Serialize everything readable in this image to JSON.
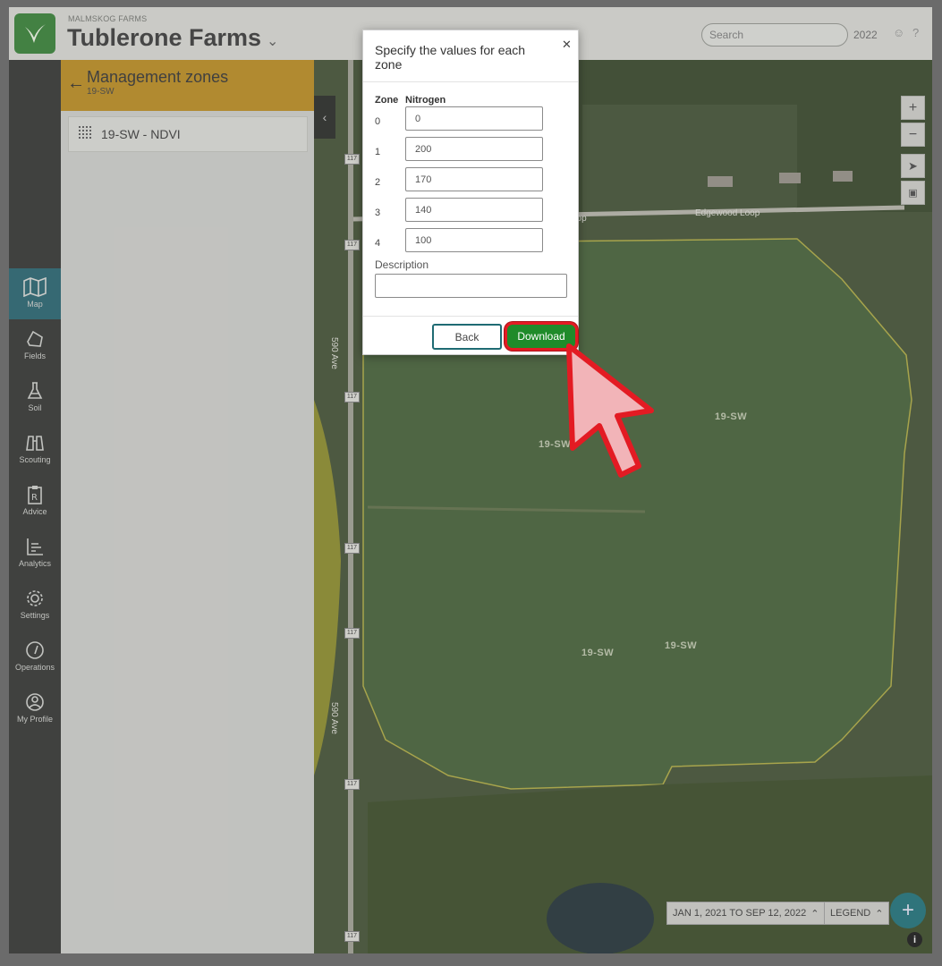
{
  "header": {
    "org": "MALMSKOG FARMS",
    "farm_name": "Tublerone Farms",
    "search_placeholder": "Search",
    "year": "2022"
  },
  "nav": [
    {
      "label": "Map",
      "icon": "map-icon",
      "active": true
    },
    {
      "label": "Fields",
      "icon": "field-icon"
    },
    {
      "label": "Soil",
      "icon": "flask-icon"
    },
    {
      "label": "Scouting",
      "icon": "binoculars-icon"
    },
    {
      "label": "Advice",
      "icon": "prescription-icon"
    },
    {
      "label": "Analytics",
      "icon": "chart-icon"
    },
    {
      "label": "Settings",
      "icon": "gear-icon"
    },
    {
      "label": "Operations",
      "icon": "gauge-icon"
    },
    {
      "label": "My Profile",
      "icon": "profile-icon"
    }
  ],
  "panel": {
    "title": "Management zones",
    "subtitle": "19-SW",
    "zone_item": "19-SW - NDVI"
  },
  "map": {
    "road_label": "Edgewood Loop",
    "road_label_left": "pop",
    "avenue_label": "590 Ave",
    "road_sign": "117",
    "field_labels": [
      "19-SW",
      "19-SW",
      "19-SW",
      "19-SW"
    ],
    "date_range": "JAN 1, 2021 TO SEP 12, 2022",
    "legend": "LEGEND"
  },
  "modal": {
    "title": "Specify the values for each zone",
    "col_zone": "Zone",
    "col_nitrogen": "Nitrogen",
    "zones": [
      {
        "zone": "0",
        "value": "0"
      },
      {
        "zone": "1",
        "value": "200"
      },
      {
        "zone": "2",
        "value": "170"
      },
      {
        "zone": "3",
        "value": "140"
      },
      {
        "zone": "4",
        "value": "100"
      }
    ],
    "description_label": "Description",
    "description_value": "",
    "back": "Back",
    "download": "Download"
  },
  "colors": {
    "accent": "#1f6b73",
    "download": "#1f8b2a",
    "highlight": "#e31b23",
    "panel_header": "#b58518"
  }
}
